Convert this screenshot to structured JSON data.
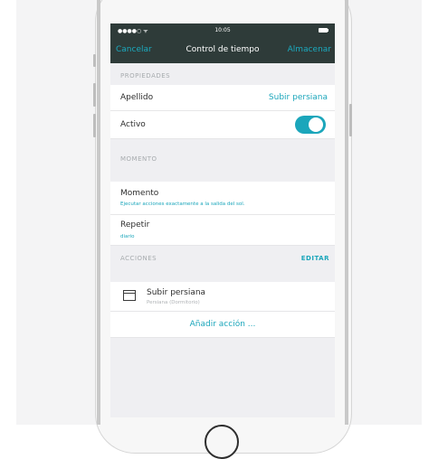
{
  "status_bar": {
    "signal": "●●●●○  ᯤ",
    "time": "10:05"
  },
  "nav": {
    "cancel_label": "Cancelar",
    "title": "Control de tiempo",
    "save_label": "Almacenar"
  },
  "sections": {
    "properties": {
      "header": "PROPIEDADES",
      "name_label": "Apellido",
      "name_value": "Subir persiana",
      "active_label": "Activo",
      "active_on": true
    },
    "moment": {
      "header": "MOMENTO",
      "moment_label": "Momento",
      "moment_description": "Ejecutar acciones exactamente a la salida del sol.",
      "repeat_label": "Repetir",
      "repeat_value": "diario"
    },
    "actions": {
      "header": "ACCIONES",
      "edit_label": "EDITAR",
      "items": [
        {
          "title": "Subir persiana",
          "subtitle": "Persiana (Dormitorio)",
          "icon": "blind-icon"
        }
      ],
      "add_label": "Añadir acción ..."
    }
  },
  "colors": {
    "accent": "#1ba6bb",
    "nav_background": "#2e3b39",
    "screen_background": "#efeff2"
  }
}
